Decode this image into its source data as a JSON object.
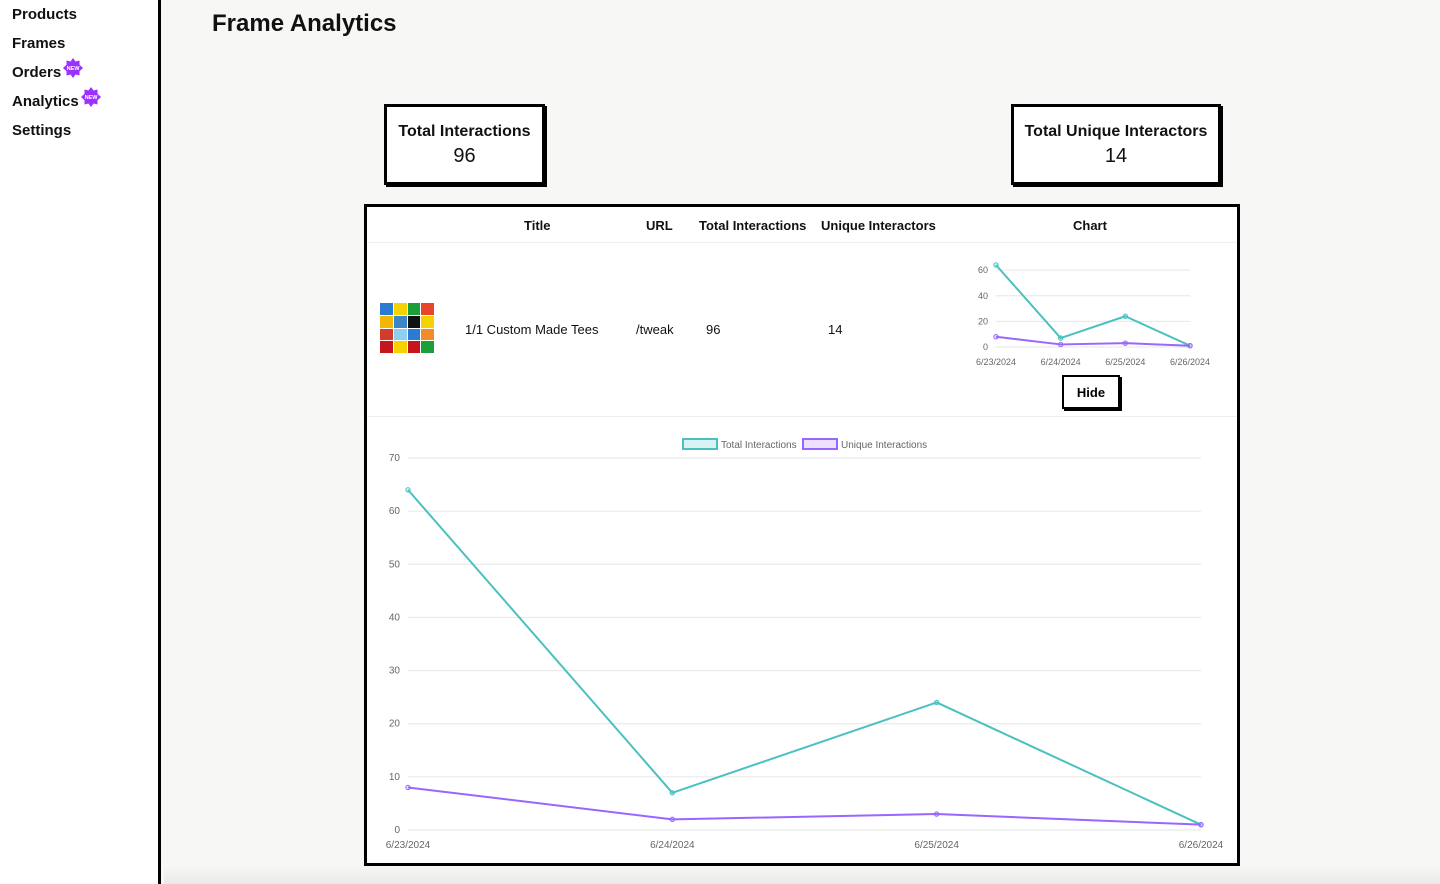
{
  "sidebar": {
    "items": [
      {
        "label": "Products",
        "badge": false
      },
      {
        "label": "Frames",
        "badge": false
      },
      {
        "label": "Orders",
        "badge": true
      },
      {
        "label": "Analytics",
        "badge": true
      },
      {
        "label": "Settings",
        "badge": false
      }
    ],
    "badge_text": "NEW",
    "badge_color": "#9b30ff"
  },
  "page": {
    "title": "Frame Analytics"
  },
  "stats": {
    "total_interactions": {
      "label": "Total Interactions",
      "value": "96"
    },
    "unique_interactors": {
      "label": "Total Unique Interactors",
      "value": "14"
    }
  },
  "table": {
    "headers": [
      "Title",
      "URL",
      "Total Interactions",
      "Unique Interactors",
      "Chart"
    ],
    "rows": [
      {
        "title": "1/1 Custom Made Tees",
        "url": "/tweak",
        "total_interactions": "96",
        "unique_interactors": "14",
        "toggle_label": "Hide"
      }
    ]
  },
  "colors": {
    "total": "#4bc0c0",
    "unique": "#9966ff"
  },
  "chart_data": [
    {
      "type": "line",
      "x": [
        "6/23/2024",
        "6/24/2024",
        "6/25/2024",
        "6/26/2024"
      ],
      "series": [
        {
          "name": "Total Interactions",
          "values": [
            64,
            7,
            24,
            1
          ]
        },
        {
          "name": "Unique Interactions",
          "values": [
            8,
            2,
            3,
            1
          ]
        }
      ],
      "yticks": [
        0,
        20,
        40,
        60
      ],
      "ylim": [
        0,
        64
      ],
      "legend": "none",
      "grid": true
    },
    {
      "type": "line",
      "x": [
        "6/23/2024",
        "6/24/2024",
        "6/25/2024",
        "6/26/2024"
      ],
      "series": [
        {
          "name": "Total Interactions",
          "values": [
            64,
            7,
            24,
            1
          ]
        },
        {
          "name": "Unique Interactions",
          "values": [
            8,
            2,
            3,
            1
          ]
        }
      ],
      "yticks": [
        0,
        10,
        20,
        30,
        40,
        50,
        60,
        70
      ],
      "ylim": [
        0,
        70
      ],
      "legend": "top",
      "grid": true
    }
  ]
}
